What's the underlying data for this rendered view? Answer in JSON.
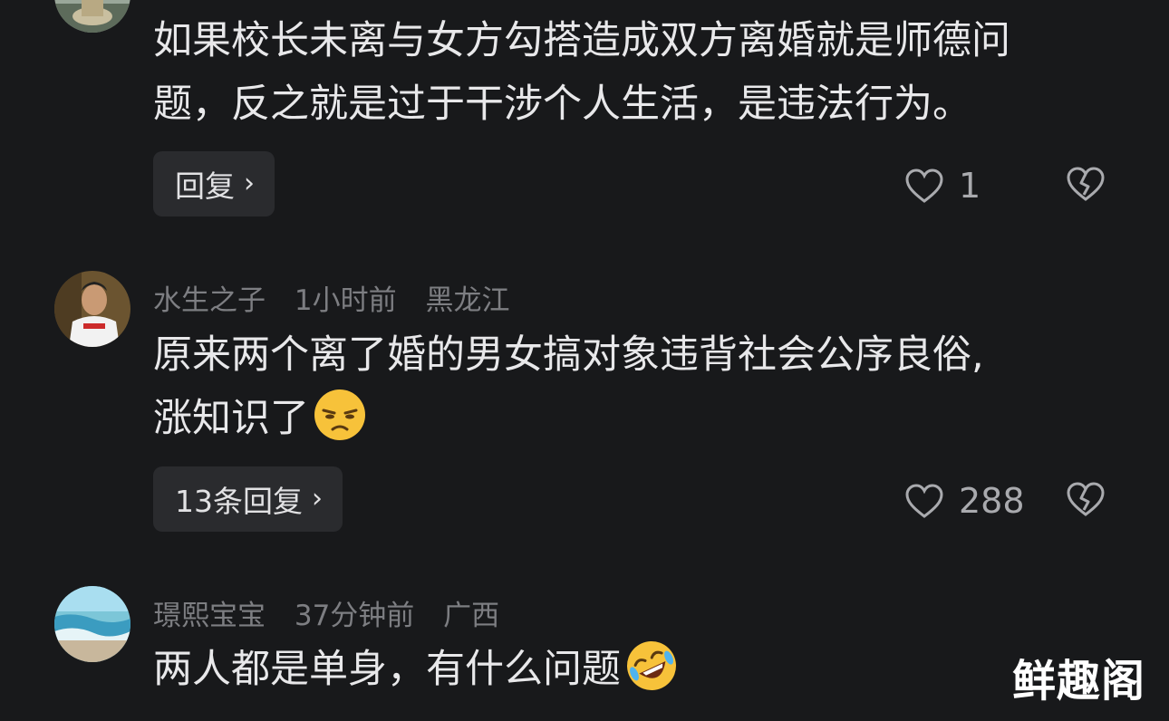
{
  "comments": [
    {
      "text_line1": "如果校长未离与女方勾搭造成双方离婚就是师德问",
      "text_line2": "题，反之就是过于干涉个人生活，是违法行为。",
      "reply_label": "回复",
      "likes": "1"
    },
    {
      "username": "水生之子",
      "time": "1小时前",
      "location": "黑龙江",
      "text_line1": "原来两个离了婚的男女搞对象违背社会公序良俗,",
      "text_line2": "涨知识了",
      "emoji": "unamused-face",
      "reply_label": "13条回复",
      "likes": "288"
    },
    {
      "username": "璟熙宝宝",
      "time": "37分钟前",
      "location": "广西",
      "text_line1": "两人都是单身，有什么问题",
      "emoji": "rolling-on-floor-laughing"
    }
  ],
  "watermark": "鲜趣阁",
  "colors": {
    "background": "#18191b",
    "text": "#e8e8ea",
    "meta": "#7d7e82",
    "button_bg": "#2a2b2e"
  }
}
